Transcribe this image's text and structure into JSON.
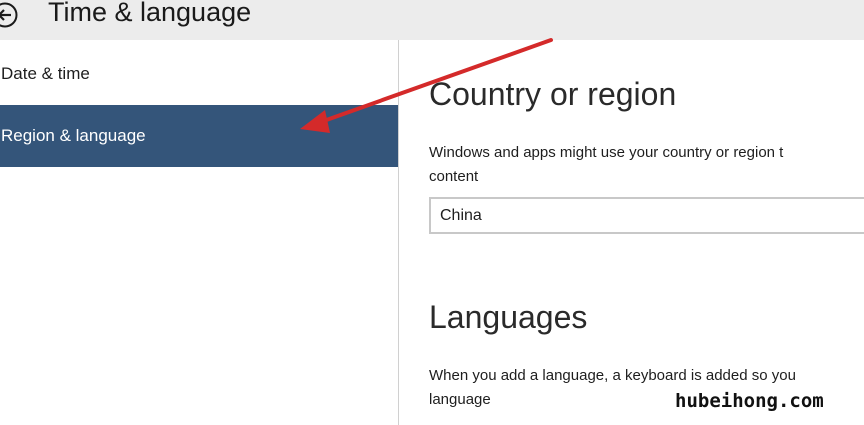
{
  "header": {
    "back_icon": "back-arrow-circle-icon",
    "title": "Time & language"
  },
  "sidebar": {
    "items": [
      {
        "label": "Date & time",
        "selected": false
      },
      {
        "label": "Region & language",
        "selected": true
      }
    ],
    "selected_color": "#34557a"
  },
  "main": {
    "country_section": {
      "heading": "Country or region",
      "description_line1": "Windows and apps might use your country or region t",
      "description_line2": "content",
      "select_value": "China"
    },
    "languages_section": {
      "heading": "Languages",
      "description_line1": "When you add a language, a keyboard is added so you",
      "description_line2": "language"
    }
  },
  "annotation": {
    "arrow_color": "#d42a2a"
  },
  "watermark": "hubeihong.com"
}
